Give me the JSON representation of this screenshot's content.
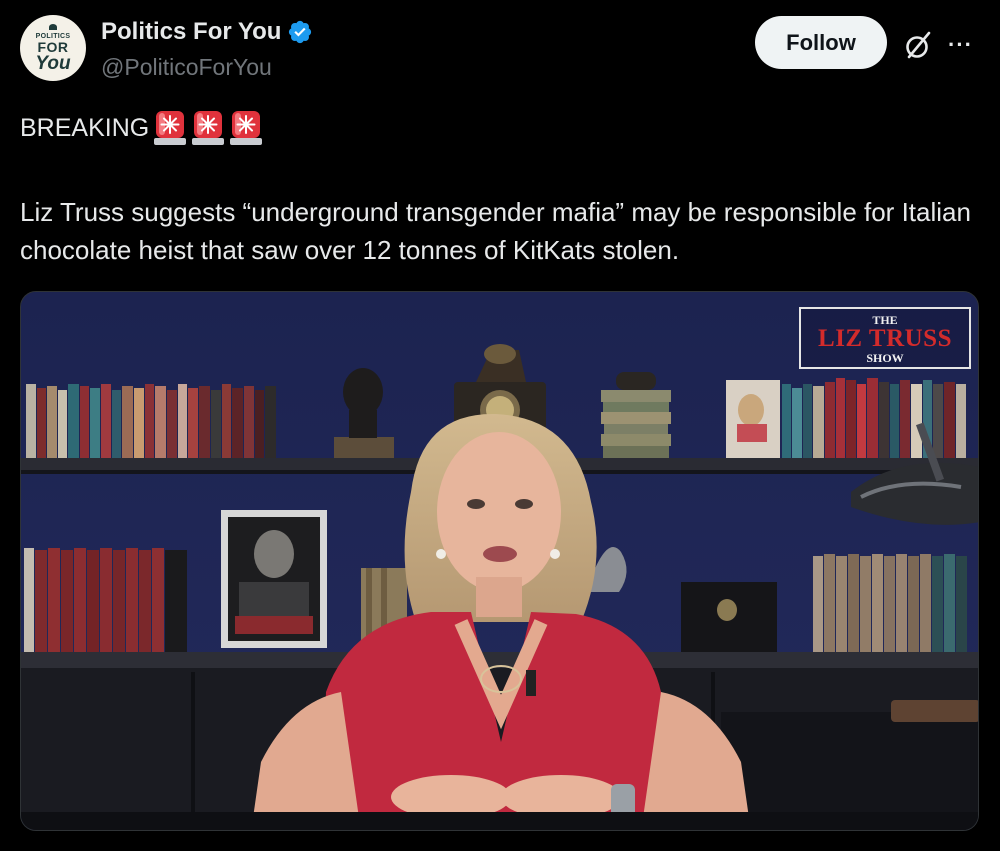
{
  "author": {
    "avatar_lines": [
      "POLITICS",
      "FOR",
      "You"
    ],
    "display_name": "Politics For You",
    "handle": "@PoliticoForYou",
    "verified": true
  },
  "actions": {
    "follow_label": "Follow",
    "grok_icon": "grok-slash-circle-icon",
    "more_label": "···"
  },
  "post": {
    "breaking_label": "BREAKING",
    "siren_emoji_count": 3,
    "text": "Liz Truss suggests “underground transgender mafia” may be responsible for Italian chocolate heist that saw over 12 tonnes of KitKats stolen."
  },
  "media": {
    "logo_top": "THE",
    "logo_name": "LIZ TRUSS",
    "logo_bottom": "SHOW"
  },
  "colors": {
    "background": "#000000",
    "text_primary": "#e7e9ea",
    "text_secondary": "#71767b",
    "verified_blue": "#1d9bf0",
    "follow_bg": "#eff3f4",
    "siren_red": "#e0323c",
    "logo_red": "#d32b2b"
  }
}
